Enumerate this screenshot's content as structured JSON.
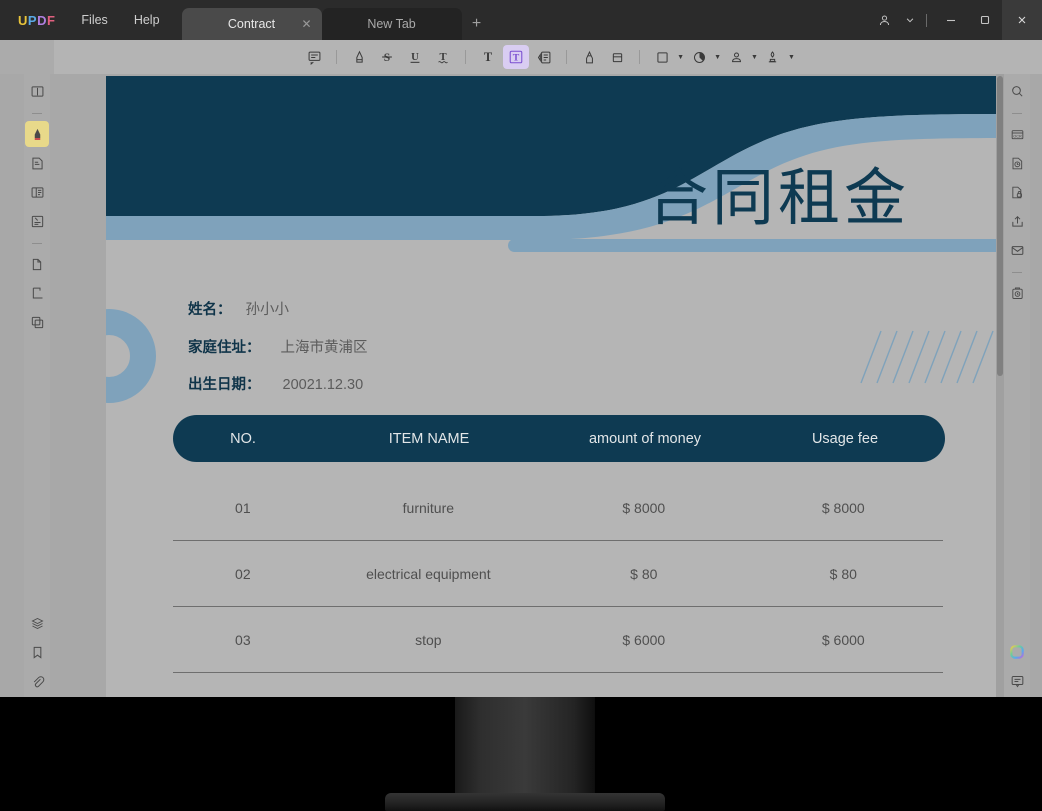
{
  "window": {
    "app_name": "UPDF",
    "logo_letters": [
      "U",
      "P",
      "D",
      "F"
    ],
    "menus": [
      {
        "label": "Files",
        "name": "menu-files"
      },
      {
        "label": "Help",
        "name": "menu-help"
      }
    ],
    "tabs": [
      {
        "label": "Contract",
        "active": true,
        "closable": true
      },
      {
        "label": "New Tab",
        "active": false,
        "closable": false
      }
    ],
    "new_tab_label": "+",
    "controls": {
      "account_icon": "person-icon",
      "account_caret": "chevron-down-icon",
      "minimize": "—",
      "maximize": "□",
      "close": "✕"
    }
  },
  "toolbar": {
    "items": [
      {
        "name": "sticky-note-tool",
        "icon": "note-icon",
        "active": false
      },
      {
        "name": "separator-1",
        "icon": "separator",
        "active": false
      },
      {
        "name": "highlight-tool",
        "icon": "highlighter-icon",
        "active": false
      },
      {
        "name": "strikethrough-tool",
        "icon": "strikethrough-s-icon",
        "active": false
      },
      {
        "name": "underline-tool",
        "icon": "underline-u-icon",
        "active": false
      },
      {
        "name": "squiggly-tool",
        "icon": "squiggly-t-icon",
        "active": false
      },
      {
        "name": "separator-2",
        "icon": "separator",
        "active": false
      },
      {
        "name": "text-tool",
        "icon": "text-t-icon",
        "active": false
      },
      {
        "name": "text-box-tool",
        "icon": "boxed-t-icon",
        "active": true
      },
      {
        "name": "text-callout-tool",
        "icon": "callout-icon",
        "active": false
      },
      {
        "name": "separator-3",
        "icon": "separator",
        "active": false
      },
      {
        "name": "pencil-tool",
        "icon": "pencil-icon",
        "active": false
      },
      {
        "name": "eraser-tool",
        "icon": "eraser-icon",
        "active": false
      },
      {
        "name": "separator-4",
        "icon": "separator",
        "active": false
      },
      {
        "name": "shape-tool",
        "icon": "square-shape-icon",
        "active": false,
        "caret": true
      },
      {
        "name": "stamp-tool",
        "icon": "stamp-circle-icon",
        "active": false,
        "caret": true
      },
      {
        "name": "signature-tool",
        "icon": "person-sign-icon",
        "active": false,
        "caret": true
      },
      {
        "name": "stamp-sign-tool",
        "icon": "stamp-pen-icon",
        "active": false,
        "caret": true
      }
    ]
  },
  "left_rail": {
    "items": [
      {
        "name": "reader-view-button",
        "icon": "book-icon",
        "active": false
      },
      {
        "name": "rail-divider-1",
        "icon": "divider",
        "active": false
      },
      {
        "name": "comment-tools-button",
        "icon": "highlighter-pen-icon",
        "active": true
      },
      {
        "name": "edit-pdf-button",
        "icon": "edit-document-icon",
        "active": false
      },
      {
        "name": "page-layout-button",
        "icon": "book-pages-icon",
        "active": false
      },
      {
        "name": "fill-sign-button",
        "icon": "form-fill-icon",
        "active": false
      },
      {
        "name": "rail-divider-2",
        "icon": "divider",
        "active": false
      },
      {
        "name": "organize-pages-button",
        "icon": "pages-icon",
        "active": false
      },
      {
        "name": "crop-page-button",
        "icon": "crop-icon",
        "active": false
      },
      {
        "name": "batch-process-button",
        "icon": "copy-stack-icon",
        "active": false
      }
    ],
    "bottom_items": [
      {
        "name": "layers-button",
        "icon": "layers-icon"
      },
      {
        "name": "bookmarks-button",
        "icon": "bookmark-icon"
      },
      {
        "name": "attachments-button",
        "icon": "paperclip-icon"
      }
    ]
  },
  "right_rail": {
    "items": [
      {
        "name": "search-button",
        "icon": "search-icon"
      },
      {
        "name": "rail-divider-1",
        "icon": "divider"
      },
      {
        "name": "ocr-button",
        "icon": "ocr-scanner-icon"
      },
      {
        "name": "compress-button",
        "icon": "compress-file-icon"
      },
      {
        "name": "protect-button",
        "icon": "lock-file-icon"
      },
      {
        "name": "share-button",
        "icon": "share-upload-icon"
      },
      {
        "name": "email-button",
        "icon": "envelope-icon"
      },
      {
        "name": "rail-divider-2",
        "icon": "divider"
      },
      {
        "name": "convert-button",
        "icon": "convert-clock-icon"
      }
    ],
    "bottom_items": [
      {
        "name": "ai-assistant-button",
        "icon": "ai-sparkle-icon"
      },
      {
        "name": "comments-panel-button",
        "icon": "comment-bubble-icon"
      }
    ]
  },
  "document": {
    "title": "合同租金",
    "fields": [
      {
        "label": "姓名：",
        "value": "孙小小"
      },
      {
        "label": "家庭住址：",
        "value": "上海市黄浦区"
      },
      {
        "label": "出生日期：",
        "value": "20021.12.30"
      }
    ],
    "table": {
      "headers": [
        "NO.",
        "ITEM NAME",
        "amount of money",
        "Usage fee"
      ],
      "rows": [
        {
          "no": "01",
          "item": "furniture",
          "amount": "$ 8000",
          "fee": "$ 8000"
        },
        {
          "no": "02",
          "item": "electrical equipment",
          "amount": "$ 80",
          "fee": "$ 80"
        },
        {
          "no": "03",
          "item": "stop",
          "amount": "$ 6000",
          "fee": "$ 6000"
        }
      ]
    }
  },
  "colors": {
    "navy": "#0e3a52",
    "steel_blue": "#7fa2bb",
    "page_bg": "#b5b5b5",
    "app_chrome": "#2b2b2b",
    "toolbar_bg": "#b4b4b4",
    "active_tool": "#d9cdf2",
    "active_rail": "#e8d98a"
  }
}
